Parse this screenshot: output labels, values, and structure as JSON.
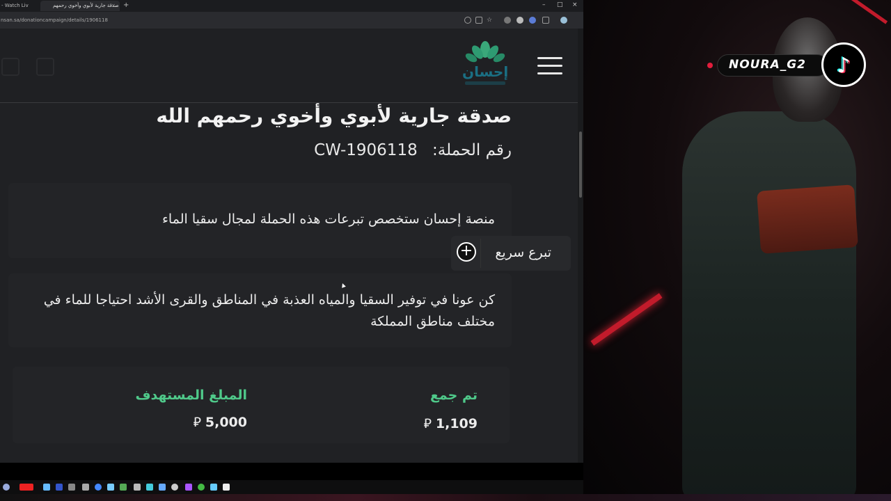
{
  "browser": {
    "tabs": [
      {
        "label": "- Watch Liv"
      },
      {
        "label": "صدقة جارية لأبوي وأخوي رحمهم"
      }
    ],
    "url": "nsan.sa/donationcampaign/details/1906118"
  },
  "site": {
    "logo_text": "إحسان"
  },
  "campaign": {
    "title": "صدقة جارية لأبوي وأخوي رحمهم الله",
    "number_label": "رقم الحملة:",
    "number_value": "CW-1906118",
    "allocation_text": "منصة إحسان ستخصص تبرعات هذه الحملة لمجال سقيا الماء",
    "description": "كن عونا في توفير السقيا والمياه العذبة في المناطق والقرى الأشد احتياجا للماء في مختلف مناطق المملكة",
    "collected_label": "تم جمع",
    "collected_value": "1,109",
    "target_label": "المبلغ المستهدف",
    "target_value": "5,000",
    "currency_symbol": "⃁"
  },
  "quick_donate": {
    "label": "تبرع سريع"
  },
  "overlay": {
    "tiktok_username": "NOURA_G2"
  },
  "colors": {
    "accent_green": "#4fc98a",
    "brand_teal": "#1a6f83"
  }
}
